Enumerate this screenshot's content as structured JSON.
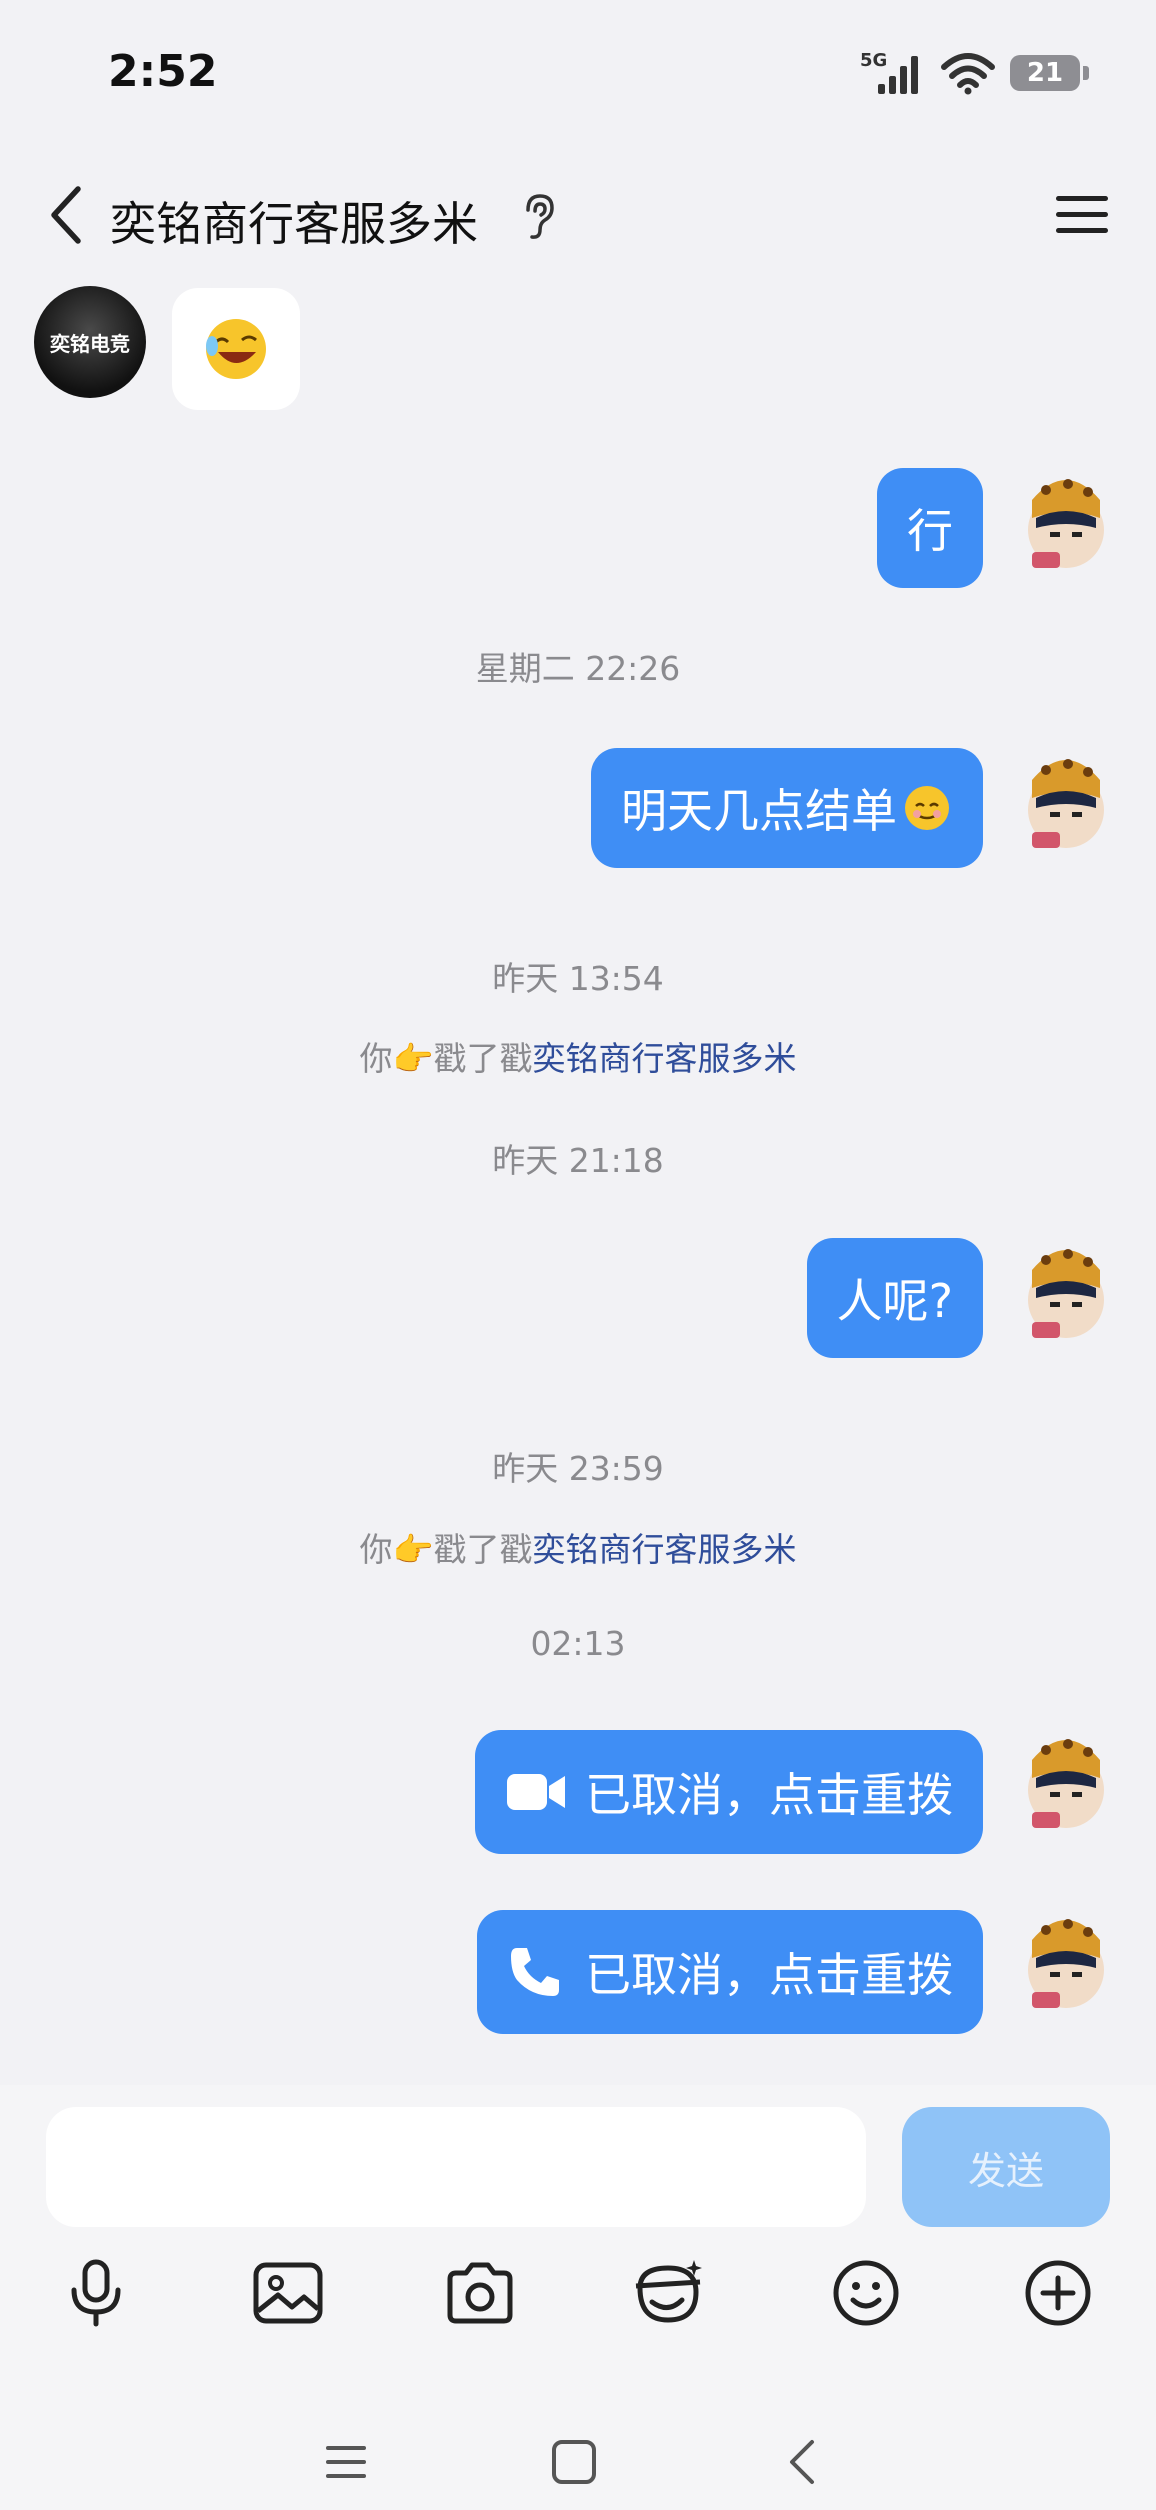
{
  "status_bar": {
    "time": "2:52",
    "network": "5G",
    "battery": "21"
  },
  "header": {
    "title": "奕铭商行客服多米"
  },
  "chat": {
    "peer_avatar_text": "奕铭电竞",
    "messages": {
      "msg1": "行",
      "ts1": "星期二 22:26",
      "msg2": "明天几点结单",
      "ts2": "昨天 13:54",
      "poke1": {
        "prefix": "你",
        "verb": "戳了戳",
        "target": "奕铭商行客服多米"
      },
      "ts3": "昨天 21:18",
      "msg3": "人呢?",
      "ts4": "昨天 23:59",
      "poke2": {
        "prefix": "你",
        "verb": "戳了戳",
        "target": "奕铭商行客服多米"
      },
      "ts5": "02:13",
      "call_video": "已取消，点击重拨",
      "call_voice": "已取消，点击重拨"
    }
  },
  "input": {
    "send_label": "发送",
    "placeholder": ""
  },
  "colors": {
    "bubble_out": "#3f8ef5",
    "send_disabled": "#8fc3f7",
    "poke_link": "#2f4d9a"
  },
  "icons": {
    "toolbar": [
      "mic-icon",
      "image-icon",
      "camera-icon",
      "sticker-icon",
      "emoji-icon",
      "plus-icon"
    ],
    "nav": [
      "recents-icon",
      "home-icon",
      "back-icon"
    ]
  }
}
